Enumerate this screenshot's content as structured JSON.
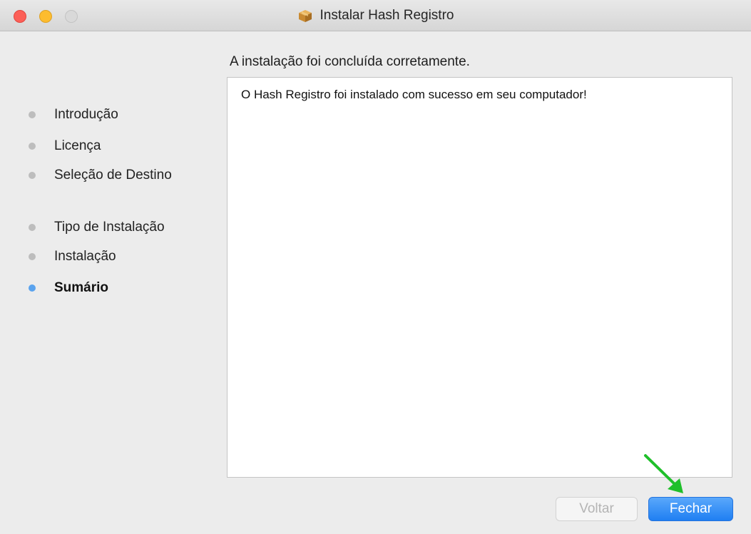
{
  "window": {
    "title": "Instalar Hash Registro",
    "title_icon": "package-icon"
  },
  "sidebar": {
    "steps": [
      {
        "label": "Introdução",
        "state": "done"
      },
      {
        "label": "Licença",
        "state": "done"
      },
      {
        "label": "Seleção de Destino",
        "state": "done"
      },
      {
        "label": "Tipo de Instalação",
        "state": "done"
      },
      {
        "label": "Instalação",
        "state": "done"
      },
      {
        "label": "Sumário",
        "state": "current"
      }
    ]
  },
  "main": {
    "heading": "A instalação foi concluída corretamente.",
    "message": "O Hash Registro foi instalado com sucesso em seu computador!"
  },
  "buttons": {
    "back_label": "Voltar",
    "back_enabled": false,
    "close_label": "Fechar"
  },
  "annotation": {
    "arrow_color": "#1fbf2a",
    "arrow_target": "close-button"
  },
  "colors": {
    "accent": "#2a85f5",
    "active_step_dot": "#5aa3ee",
    "inactive_step_dot": "#bdbdbd"
  }
}
